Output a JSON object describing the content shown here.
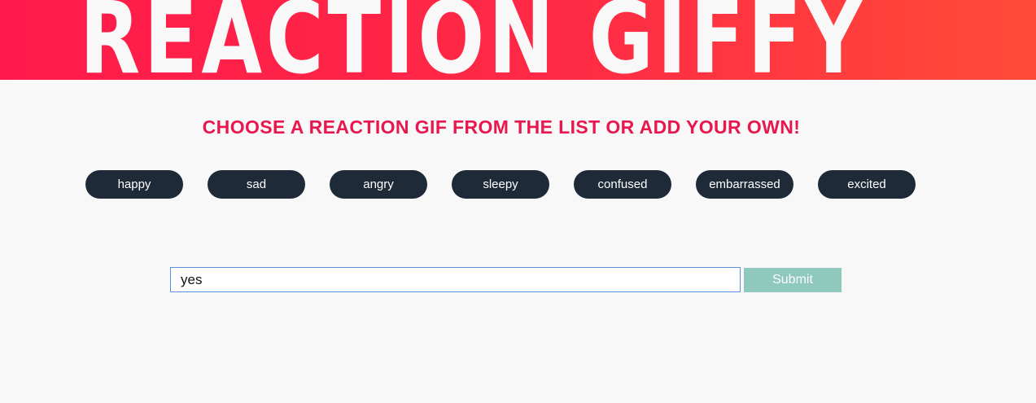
{
  "header": {
    "title": "REACTION GIFFY",
    "gradient_start": "#ff1a4b",
    "gradient_end": "#ff4b38"
  },
  "main": {
    "subtitle": "CHOOSE A REACTION GIF FROM THE LIST OR ADD YOUR OWN!",
    "subtitle_color": "#e8174d",
    "reactions": [
      "happy",
      "sad",
      "angry",
      "sleepy",
      "confused",
      "embarrassed",
      "excited"
    ],
    "reaction_button_color": "#1f2a38"
  },
  "form": {
    "input_value": "yes",
    "submit_label": "Submit",
    "submit_color": "#8fc8bd"
  },
  "page": {
    "background": "#f8f8f8"
  }
}
